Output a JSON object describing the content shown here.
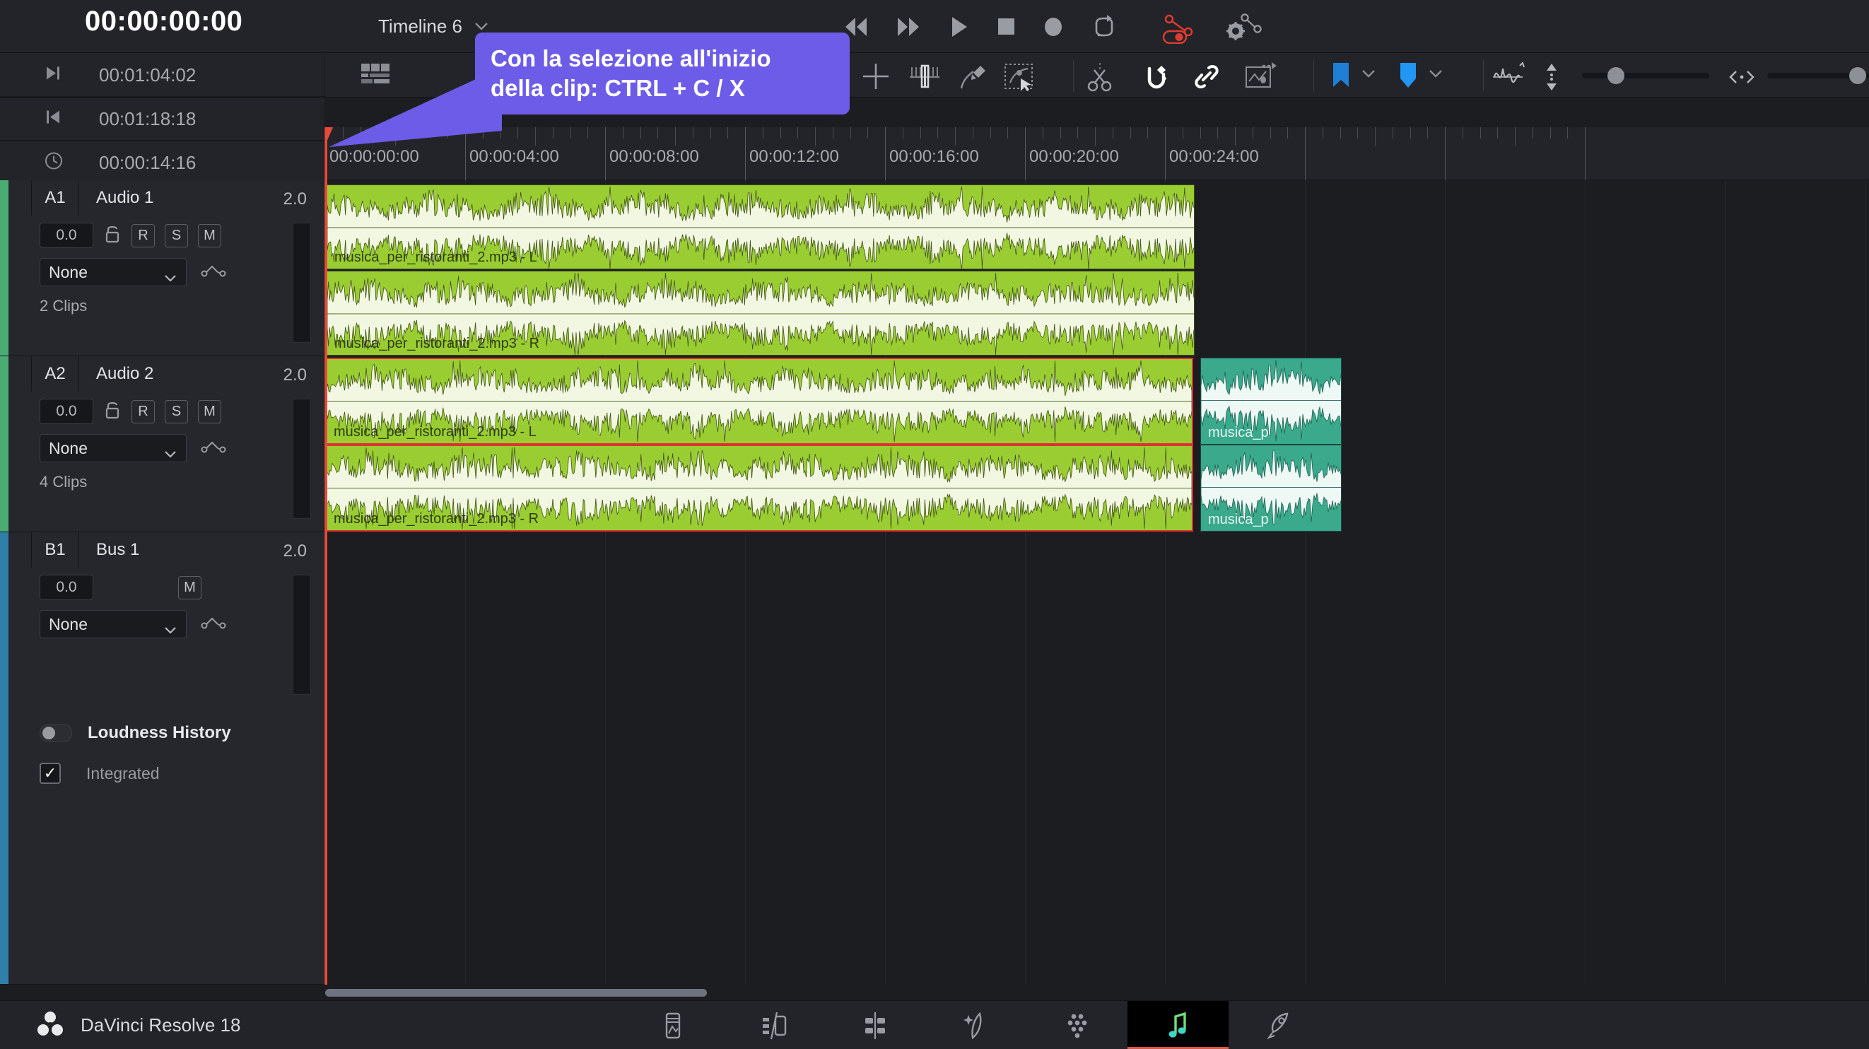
{
  "app": {
    "name": "DaVinci Resolve 18",
    "logo_icon": "resolve-logo-icon"
  },
  "transport": {
    "timecode": "00:00:00:00",
    "timeline_name": "Timeline 6",
    "buttons": [
      {
        "name": "jump-to-start-button",
        "icon": "rewind-icon"
      },
      {
        "name": "fast-forward-button",
        "icon": "fast-forward-icon"
      },
      {
        "name": "play-button",
        "icon": "play-icon"
      },
      {
        "name": "stop-button",
        "icon": "stop-icon"
      },
      {
        "name": "record-button",
        "icon": "record-icon"
      },
      {
        "name": "loop-button",
        "icon": "loop-icon"
      }
    ],
    "automation_toggle": {
      "name": "automation-toggle",
      "icon": "automation-icon",
      "color": "#e03b30",
      "active": true
    },
    "keyframe_settings": {
      "name": "keyframe-settings-button",
      "icon": "gear-curve-icon"
    }
  },
  "timecode_rows": [
    {
      "icon": "end-marker-icon",
      "value": "00:01:04:02",
      "name": "duration-out-timecode"
    },
    {
      "icon": "start-marker-icon",
      "value": "00:01:18:18",
      "name": "duration-in-timecode"
    },
    {
      "icon": "clock-icon",
      "value": "00:00:14:16",
      "name": "selection-duration-timecode"
    }
  ],
  "toolbar": {
    "left": [
      {
        "name": "timeline-view-options-button",
        "icon": "timeline-view-icon"
      }
    ],
    "tools": [
      {
        "name": "selection-tool-button",
        "icon": "crosshair-icon"
      },
      {
        "name": "trim-edit-tool-button",
        "icon": "trim-icon"
      },
      {
        "name": "pencil-tool-button",
        "icon": "pencil-icon"
      },
      {
        "name": "range-select-tool-button",
        "icon": "range-select-icon"
      },
      {
        "name": "razor-tool-button",
        "icon": "scissors-icon"
      },
      {
        "name": "snapping-toggle-button",
        "icon": "magnet-icon",
        "active": true
      },
      {
        "name": "link-clips-button",
        "icon": "link-icon",
        "active": true
      },
      {
        "name": "automation-follow-button",
        "icon": "flow-arrow-icon"
      }
    ],
    "markers": [
      {
        "name": "marker-flag-button",
        "icon": "flag-icon",
        "color": "#1f7fd4"
      },
      {
        "name": "marker-flag-dropdown",
        "icon": "chevron-down-icon"
      },
      {
        "name": "marker-color-button",
        "icon": "marker-icon",
        "color": "#2196f3"
      },
      {
        "name": "marker-color-dropdown",
        "icon": "chevron-down-icon"
      }
    ],
    "right": [
      {
        "name": "waveform-display-button",
        "icon": "waveform-icon"
      },
      {
        "name": "track-height-button",
        "icon": "vertical-resize-icon"
      },
      {
        "name": "vertical-zoom-slider",
        "icon": "slider-icon",
        "value": 22
      },
      {
        "name": "timeline-fit-button",
        "icon": "fit-timeline-icon"
      },
      {
        "name": "horizontal-zoom-slider",
        "icon": "slider-icon",
        "value": 72
      }
    ]
  },
  "callout": {
    "line1": "Con la selezione all'inizio",
    "line2": "della clip: CTRL + C / X",
    "color": "#6c5ce7"
  },
  "ruler": {
    "labels": [
      "00:00:00:00",
      "00:00:04:00",
      "00:00:08:00",
      "00:00:12:00",
      "00:00:16:00",
      "00:00:20:00",
      "00:00:24:00"
    ],
    "positions": [
      0,
      198,
      396,
      594,
      792,
      990,
      1188
    ]
  },
  "tracks": [
    {
      "id": "A1",
      "name": "Audio 1",
      "channels": "2.0",
      "gain": "0.0",
      "clip_count": "2 Clips",
      "color": "#4bab74",
      "lock_icon": "lock-icon",
      "buttons": [
        "R",
        "S",
        "M"
      ],
      "effect": "None",
      "automation_icon": "automation-curve-icon"
    },
    {
      "id": "A2",
      "name": "Audio 2",
      "channels": "2.0",
      "gain": "0.0",
      "clip_count": "4 Clips",
      "color": "#4bab74",
      "lock_icon": "lock-icon",
      "buttons": [
        "R",
        "S",
        "M"
      ],
      "effect": "None",
      "automation_icon": "automation-curve-icon"
    },
    {
      "id": "B1",
      "name": "Bus 1",
      "channels": "2.0",
      "gain": "0.0",
      "clip_count": "",
      "color": "#2f7fa8",
      "lock_icon": "",
      "buttons": [
        "M"
      ],
      "effect": "None",
      "automation_icon": "automation-curve-icon"
    }
  ],
  "clips": [
    {
      "name": "musica_per_ristoranti_2.mp3 - L",
      "track": "A1",
      "selected": false,
      "color": "#9acd32"
    },
    {
      "name": "musica_per_ristoranti_2.mp3 - R",
      "track": "A1",
      "selected": false,
      "color": "#9acd32"
    },
    {
      "name": "musica_per_ristoranti_2.mp3 - L",
      "track": "A2",
      "selected": true,
      "color": "#9acd32"
    },
    {
      "name": "musica_per_ristoranti_2.mp3 - R",
      "track": "A2",
      "selected": true,
      "color": "#9acd32"
    },
    {
      "name": "musica_p",
      "track": "A2",
      "selected": false,
      "color": "#3aa98c"
    },
    {
      "name": "musica_p",
      "track": "A2",
      "selected": false,
      "color": "#3aa98c"
    }
  ],
  "loudness": {
    "title": "Loudness History",
    "toggle_on": false,
    "metric_checked": true,
    "metric_label": "Integrated"
  },
  "pages": [
    {
      "name": "page-media",
      "icon": "media-icon",
      "active": false
    },
    {
      "name": "page-cut",
      "icon": "cut-icon",
      "active": false
    },
    {
      "name": "page-edit",
      "icon": "edit-icon",
      "active": false
    },
    {
      "name": "page-fusion",
      "icon": "fusion-icon",
      "active": false
    },
    {
      "name": "page-color",
      "icon": "color-icon",
      "active": false
    },
    {
      "name": "page-fairlight",
      "icon": "fairlight-icon",
      "active": true
    },
    {
      "name": "page-deliver",
      "icon": "deliver-icon",
      "active": false
    }
  ]
}
